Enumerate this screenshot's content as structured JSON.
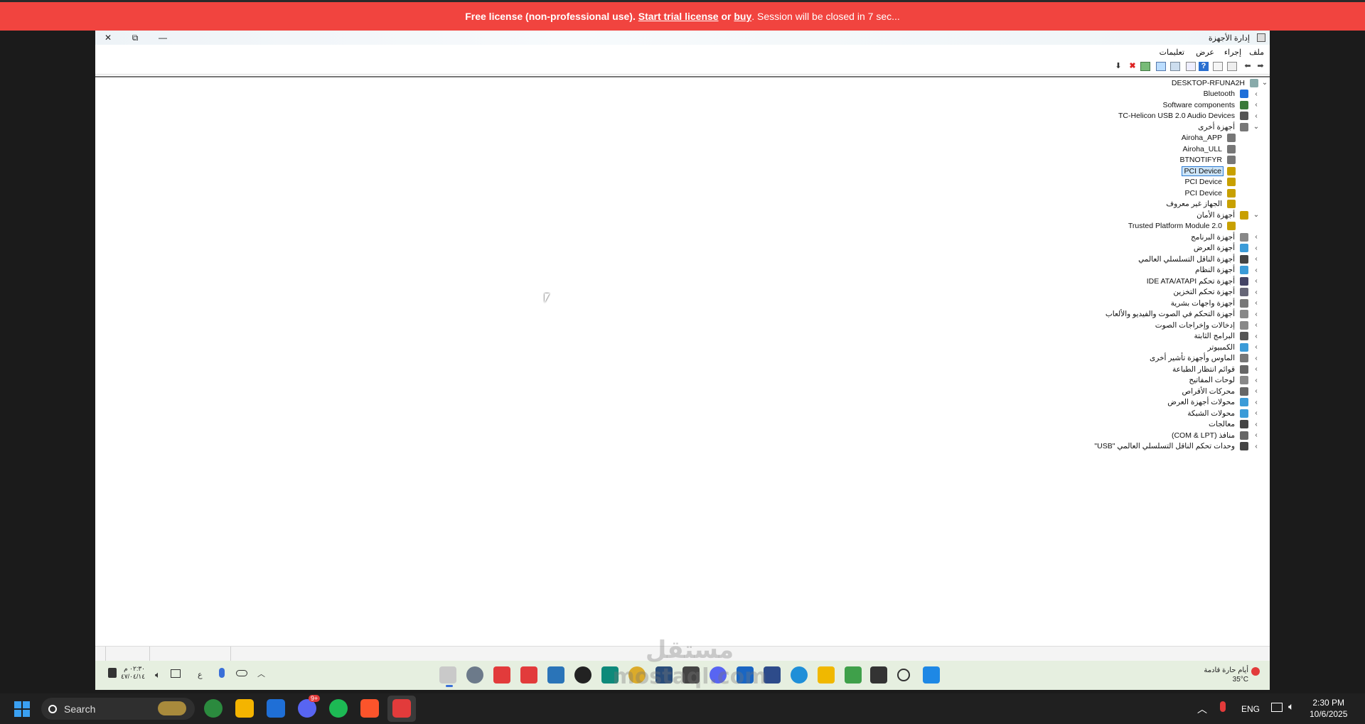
{
  "banner": {
    "lead": "Free license (non-professional use).",
    "trial_link": "Start trial license",
    "or_text": "or",
    "buy_link": "buy",
    "tail": ". Session will be closed in 7 sec..."
  },
  "window": {
    "title": "إدارة الأجهزة",
    "minimize_icon": "—",
    "restore_icon": "⧉",
    "close_icon": "✕"
  },
  "menu": [
    "ملف",
    "إجراء",
    "عرض",
    "تعليمات"
  ],
  "toolbar_icons": [
    "back-arrow-icon",
    "forward-arrow-icon",
    "properties-icon",
    "help-icon",
    "show-hide-console-icon",
    "scan-hardware-icon",
    "update-driver-icon",
    "remove-icon",
    "disable-icon",
    "download-icon"
  ],
  "tree": {
    "root": "DESKTOP-RFUNA2H",
    "nodes": [
      {
        "label": "Bluetooth",
        "level": 1,
        "expanded": false,
        "color": "#1e6fd9"
      },
      {
        "label": "Software components",
        "level": 1,
        "expanded": false,
        "color": "#3a7a3a"
      },
      {
        "label": "TC-Helicon USB 2.0 Audio Devices",
        "level": 1,
        "expanded": false,
        "color": "#555"
      },
      {
        "label": "أجهزة أخرى",
        "level": 1,
        "expanded": true,
        "color": "#777"
      },
      {
        "label": "Airoha_APP",
        "level": 2,
        "color": "#777"
      },
      {
        "label": "Airoha_ULL",
        "level": 2,
        "color": "#777"
      },
      {
        "label": "BTNOTIFYR",
        "level": 2,
        "color": "#777"
      },
      {
        "label": "PCI Device",
        "level": 2,
        "color": "#c8a000",
        "selected": true
      },
      {
        "label": "PCI Device",
        "level": 2,
        "color": "#c8a000"
      },
      {
        "label": "PCI Device",
        "level": 2,
        "color": "#c8a000"
      },
      {
        "label": "الجهاز غير معروف",
        "level": 2,
        "color": "#c8a000"
      },
      {
        "label": "أجهزة الأمان",
        "level": 1,
        "expanded": true,
        "color": "#c8a000"
      },
      {
        "label": "Trusted Platform Module 2.0",
        "level": 2,
        "color": "#c8a000"
      },
      {
        "label": "أجهزة البرنامج",
        "level": 1,
        "expanded": false,
        "color": "#888"
      },
      {
        "label": "أجهزة العرض",
        "level": 1,
        "expanded": false,
        "color": "#3b9bd8"
      },
      {
        "label": "أجهزة الناقل التسلسلي العالمي",
        "level": 1,
        "expanded": false,
        "color": "#444"
      },
      {
        "label": "أجهزة النظام",
        "level": 1,
        "expanded": false,
        "color": "#3b9bd8"
      },
      {
        "label": "أجهزة تحكم IDE ATA/ATAPI",
        "level": 1,
        "expanded": false,
        "color": "#446"
      },
      {
        "label": "أجهزة تحكم التخزين",
        "level": 1,
        "expanded": false,
        "color": "#667"
      },
      {
        "label": "أجهزة واجهات بشرية",
        "level": 1,
        "expanded": false,
        "color": "#777"
      },
      {
        "label": "أجهزة التحكم في الصوت والفيديو والألعاب",
        "level": 1,
        "expanded": false,
        "color": "#888"
      },
      {
        "label": "إدخالات وإخراجات الصوت",
        "level": 1,
        "expanded": false,
        "color": "#888"
      },
      {
        "label": "البرامج الثابتة",
        "level": 1,
        "expanded": false,
        "color": "#555"
      },
      {
        "label": "الكمبيوتر",
        "level": 1,
        "expanded": false,
        "color": "#3b9bd8"
      },
      {
        "label": "الماوس وأجهزة تأشير أخرى",
        "level": 1,
        "expanded": false,
        "color": "#777"
      },
      {
        "label": "قوائم انتظار الطباعة",
        "level": 1,
        "expanded": false,
        "color": "#666"
      },
      {
        "label": "لوحات المفاتيح",
        "level": 1,
        "expanded": false,
        "color": "#888"
      },
      {
        "label": "محركات الأقراص",
        "level": 1,
        "expanded": false,
        "color": "#666"
      },
      {
        "label": "محولات أجهزة العرض",
        "level": 1,
        "expanded": false,
        "color": "#3b9bd8"
      },
      {
        "label": "محولات الشبكة",
        "level": 1,
        "expanded": false,
        "color": "#3b9bd8"
      },
      {
        "label": "معالجات",
        "level": 1,
        "expanded": false,
        "color": "#444"
      },
      {
        "label": "منافذ (COM & LPT)",
        "level": 1,
        "expanded": false,
        "color": "#666"
      },
      {
        "label": "وحدات تحكم الناقل التسلسلي العالمي \"USB\"",
        "level": 1,
        "expanded": false,
        "color": "#444"
      }
    ]
  },
  "remote_taskbar": {
    "weather_line1": "أيام حارة قادمة",
    "weather_line2": "35°C",
    "time": "٠٢:٣٠ م",
    "date": "٤٧/٠٤/١٤",
    "lang": "ع"
  },
  "watermark": {
    "line1": "مستقل",
    "line2": "mostaql.com"
  },
  "local_taskbar": {
    "search_placeholder": "Search",
    "badge": "9+",
    "lang": "ENG",
    "time": "2:30 PM",
    "date": "10/6/2025"
  }
}
